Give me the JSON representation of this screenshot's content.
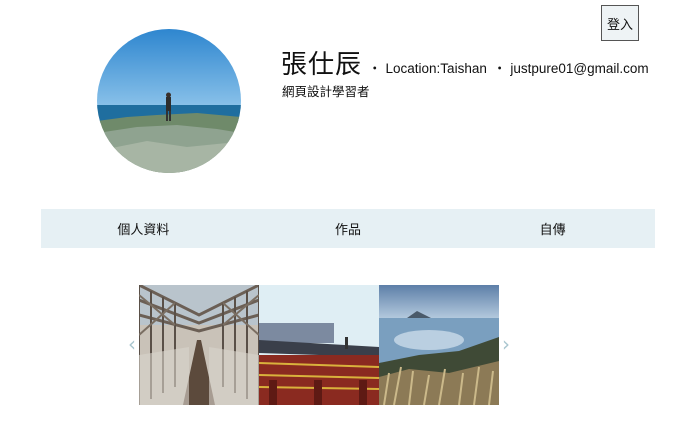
{
  "header": {
    "login_label": "登入",
    "name": "張仕辰",
    "location": "Location:Taishan",
    "email": "justpure01@gmail.com",
    "separator": "・",
    "subtitle": "網頁設計學習者"
  },
  "nav": {
    "items": [
      {
        "label": "個人資料"
      },
      {
        "label": "作品"
      },
      {
        "label": "自傳"
      }
    ]
  },
  "carousel": {
    "prev_icon": "chevron-left-icon",
    "next_icon": "chevron-right-icon",
    "prev_glyph": "‹",
    "next_glyph": "›"
  },
  "colors": {
    "nav_background": "#e6f0f4",
    "arrow": "#a9c6cf"
  }
}
